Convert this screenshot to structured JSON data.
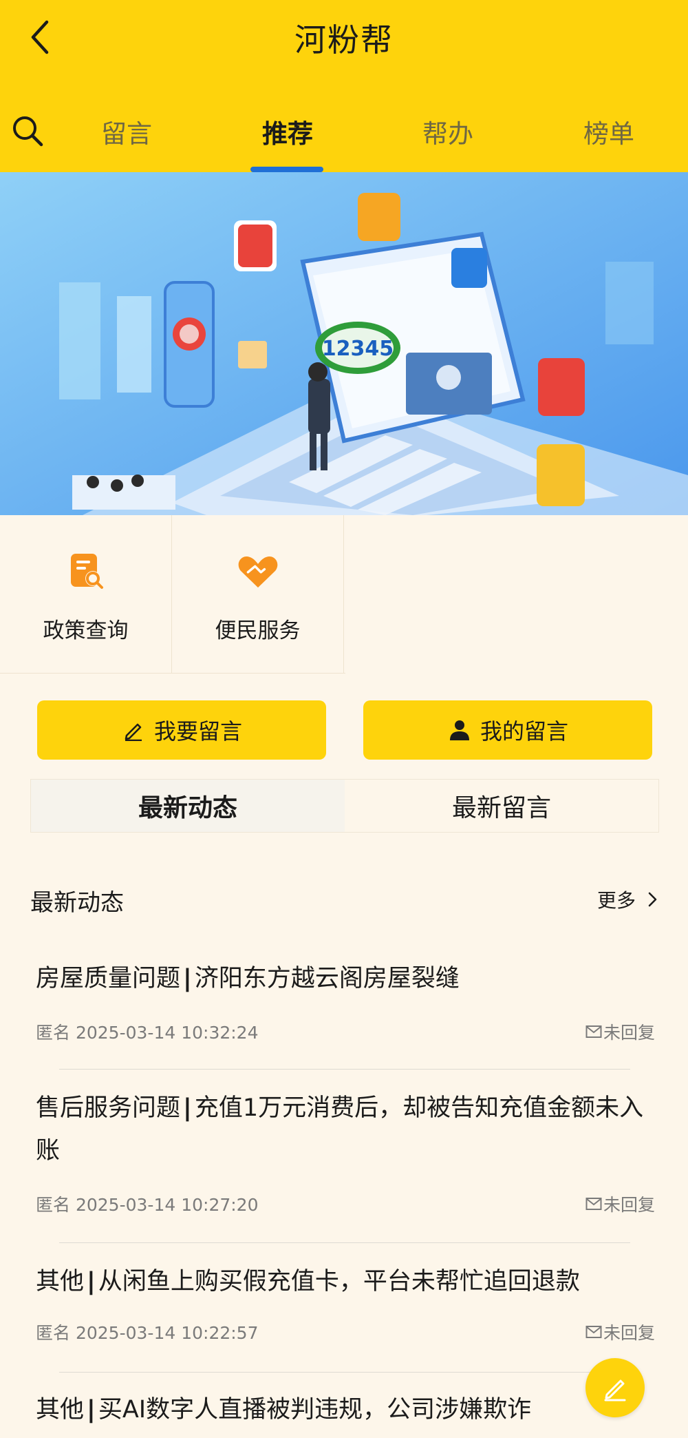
{
  "header": {
    "title": "河粉帮",
    "tabs": [
      {
        "label": "留言"
      },
      {
        "label": "推荐"
      },
      {
        "label": "帮办"
      },
      {
        "label": "榜单"
      }
    ],
    "active_tab": "推荐"
  },
  "banner": {
    "sign_text": "12345"
  },
  "quick_links": [
    {
      "label": "政策查询",
      "icon": "document-search-icon",
      "color": "#f7931e"
    },
    {
      "label": "便民服务",
      "icon": "handshake-heart-icon",
      "color": "#f7931e"
    }
  ],
  "actions": {
    "post_label": "我要留言",
    "mine_label": "我的留言"
  },
  "segments": [
    {
      "label": "最新动态"
    },
    {
      "label": "最新留言"
    }
  ],
  "feed": {
    "section_title": "最新动态",
    "more_label": "更多",
    "items": [
      {
        "category": "房屋质量问题",
        "title": "济阳东方越云阁房屋裂缝",
        "author": "匿名",
        "time": "2025-03-14 10:32:24",
        "status": "未回复"
      },
      {
        "category": "售后服务问题",
        "title": "充值1万元消费后，却被告知充值金额未入账",
        "author": "匿名",
        "time": "2025-03-14 10:27:20",
        "status": "未回复"
      },
      {
        "category": "其他",
        "title": "从闲鱼上购买假充值卡，平台未帮忙追回退款",
        "author": "匿名",
        "time": "2025-03-14 10:22:57",
        "status": "未回复"
      },
      {
        "category": "其他",
        "title": "买AI数字人直播被判违规，公司涉嫌欺诈",
        "author": "",
        "time": "",
        "status": ""
      }
    ]
  },
  "colors": {
    "brand_yellow": "#fed30c",
    "tab_indicator": "#1f6fd6",
    "page_bg": "#fdf6ea"
  }
}
